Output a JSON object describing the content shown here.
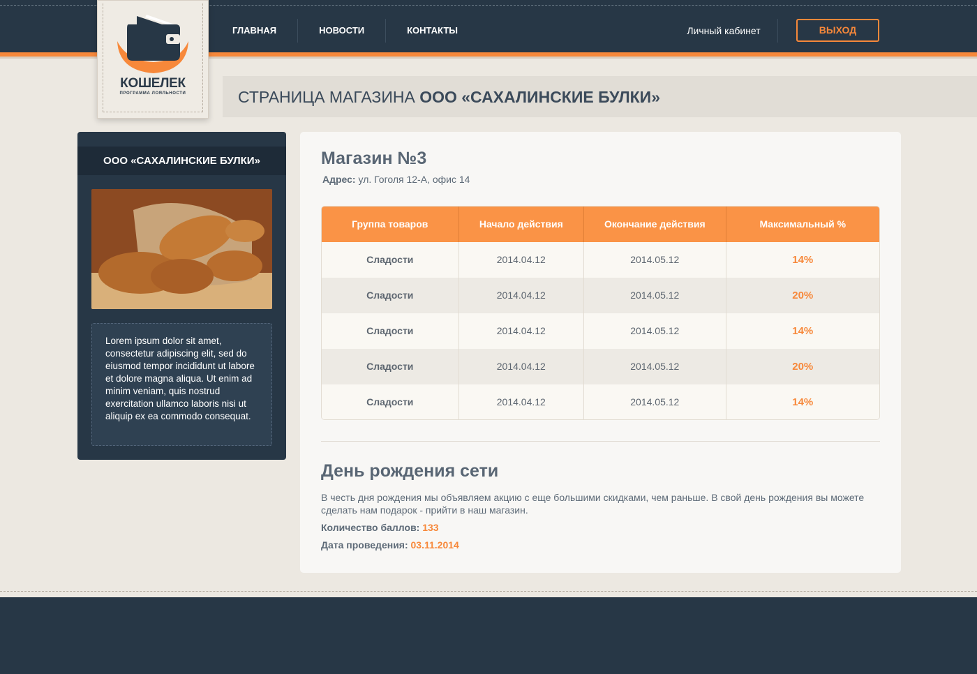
{
  "header": {
    "nav": [
      "ГЛАВНАЯ",
      "НОВОСТИ",
      "КОНТАКТЫ"
    ],
    "cabinet_label": "Личный кабинет",
    "logout_label": "ВЫХОД"
  },
  "logo": {
    "name": "КОШЕЛЕК",
    "tagline": "ПРОГРАММА ЛОЯЛЬНОСТИ"
  },
  "page_title": {
    "prefix": "СТРАНИЦА МАГАЗИНА ",
    "company": "ООО «САХАЛИНСКИЕ БУЛКИ»"
  },
  "sidebar": {
    "company": "ООО «САХАЛИНСКИЕ БУЛКИ»",
    "description": "Lorem ipsum dolor sit amet, consectetur adipiscing elit, sed do eiusmod tempor incididunt ut labore et dolore magna aliqua. Ut enim ad minim veniam, quis nostrud exercitation ullamco laboris nisi ut aliquip ex ea commodo consequat."
  },
  "shop": {
    "title": "Магазин №3",
    "address_label": "Адрес:",
    "address_value": " ул. Гоголя 12-А, офис 14"
  },
  "table": {
    "headers": [
      "Группа товаров",
      "Начало действия",
      "Окончание действия",
      "Максимальный %"
    ],
    "rows": [
      [
        "Сладости",
        "2014.04.12",
        "2014.05.12",
        "14%"
      ],
      [
        "Сладости",
        "2014.04.12",
        "2014.05.12",
        "20%"
      ],
      [
        "Сладости",
        "2014.04.12",
        "2014.05.12",
        "14%"
      ],
      [
        "Сладости",
        "2014.04.12",
        "2014.05.12",
        "20%"
      ],
      [
        "Сладости",
        "2014.04.12",
        "2014.05.12",
        "14%"
      ]
    ]
  },
  "promo": {
    "title": "День рождения сети",
    "text": "В честь дня рождения мы объявляем акцию с еще большими скидками, чем раньше. В свой день рождения вы можете сделать нам подарок - прийти в наш магазин.",
    "points_label": "Количество баллов: ",
    "points_value": "133",
    "date_label": "Дата проведения: ",
    "date_value": "03.11.2014"
  },
  "colors": {
    "accent": "#f7883a",
    "dark": "#273746",
    "background": "#ece8e1"
  }
}
